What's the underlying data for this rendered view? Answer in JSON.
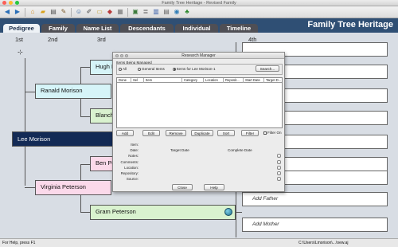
{
  "window": {
    "title": "Family Tree Heritage - Revised Family"
  },
  "toolbar": {
    "icons": [
      "back-icon",
      "forward-icon",
      "home-icon",
      "open-folder-icon",
      "print-icon",
      "tools-icon",
      "person-icon",
      "edit-icon",
      "note-icon",
      "tag-icon",
      "calendar-icon",
      "image-icon",
      "sources-icon",
      "chart-icon",
      "report-icon",
      "map-icon",
      "tree-icon"
    ]
  },
  "tabs": [
    {
      "label": "Pedigree",
      "active": true
    },
    {
      "label": "Family"
    },
    {
      "label": "Name List"
    },
    {
      "label": "Descendants"
    },
    {
      "label": "Individual"
    },
    {
      "label": "Timeline"
    }
  ],
  "brand": "Family Tree Heritage",
  "generations": {
    "g1": "1st",
    "g2": "2nd",
    "g3": "3rd",
    "g4": "4th"
  },
  "pedigree": {
    "root": "Lee Morison",
    "father": "Ranald Morison",
    "mother": "Virginia Peterson",
    "paternal_grandfather": "Hugh M",
    "paternal_grandmother": "Blanch",
    "maternal_grandfather": "Ben Pe",
    "maternal_grandmother": "Gram Peterson",
    "add_father": "Add Father",
    "add_mother": "Add Mother"
  },
  "dialog": {
    "title": "Research Manager",
    "group_label": "Items Being Managed",
    "radio_all": "All",
    "radio_general": "General Items",
    "radio_person": "Items for Lee Morison-1",
    "search_button": "Search...",
    "columns": [
      "Done",
      "Sel",
      "Item",
      "Category",
      "Location",
      "Reposit...",
      "Start Date",
      "Target D..."
    ],
    "buttons": {
      "add": "Add",
      "edit": "Edit",
      "remove": "Remove",
      "duplicate": "Duplicate",
      "sort": "Sort",
      "filter": "Filter"
    },
    "filter_on": "Filter On",
    "fields": {
      "item": "Item:",
      "date": "Date:",
      "notes": "Notes:",
      "comments": "Comments:",
      "location": "Location:",
      "repository": "Repository:",
      "source": "Source:"
    },
    "target_date": "Target Date",
    "complete_date": "Complete Date",
    "close_button": "Close",
    "help_button": "Help"
  },
  "status": {
    "left": "For Help, press F1",
    "right": "C:\\Users\\Lmorison\\...\\new.aj"
  },
  "colors": {
    "root_bg": "#132a55",
    "male_bg": "#d6f4f8",
    "female_bg": "#fbd9ea",
    "green_bg": "#d9f2cf",
    "tabbar": "#2f4f74"
  }
}
